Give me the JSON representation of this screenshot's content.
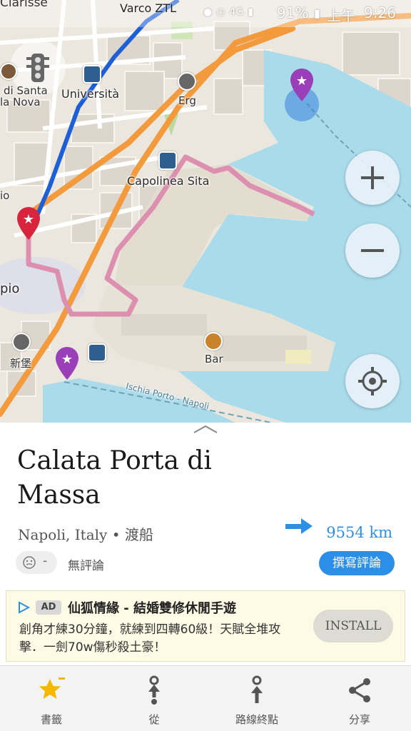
{
  "status_bar": {
    "carrier_label": "Clarisse",
    "battery": "91%",
    "ampm": "上午",
    "time": "9:26"
  },
  "map": {
    "labels": {
      "varco": "Varco ZTL",
      "di_santa": "di Santa",
      "la_nova": "la Nova",
      "universita": "Università",
      "erg": "Erg",
      "capolinea": "Capolinea Sita",
      "pio": "pio",
      "io": "io",
      "xinbao": "新堡",
      "bar": "Bar",
      "ischia": "Ischia Porto - Napoli"
    },
    "route_color": "#1d5fd6",
    "water_color": "#a9dbeb",
    "highway_color": "#f39a3c"
  },
  "panel": {
    "title": "Calata Porta di Massa",
    "subtitle": "Napoli, Italy • 渡船",
    "distance": "9554 km",
    "rating_dash": "-",
    "no_reviews": "無評論",
    "write_review": "撰寫評論"
  },
  "ad": {
    "badge": "AD",
    "title": "仙狐情緣 - 結婚雙修休閒手遊",
    "description": "創角才練30分鐘，就練到四轉60級！天賦全堆攻擊．一劍70w傷秒殺土豪！",
    "install": "INSTALL"
  },
  "bottom_bar": {
    "bookmarks": "書籤",
    "from": "從",
    "route_end": "路線終點",
    "share": "分享"
  },
  "colors": {
    "accent_blue": "#2b8fe8",
    "star_yellow": "#f5b800",
    "pin_red": "#d9243d",
    "pin_purple": "#9b3fb8"
  }
}
